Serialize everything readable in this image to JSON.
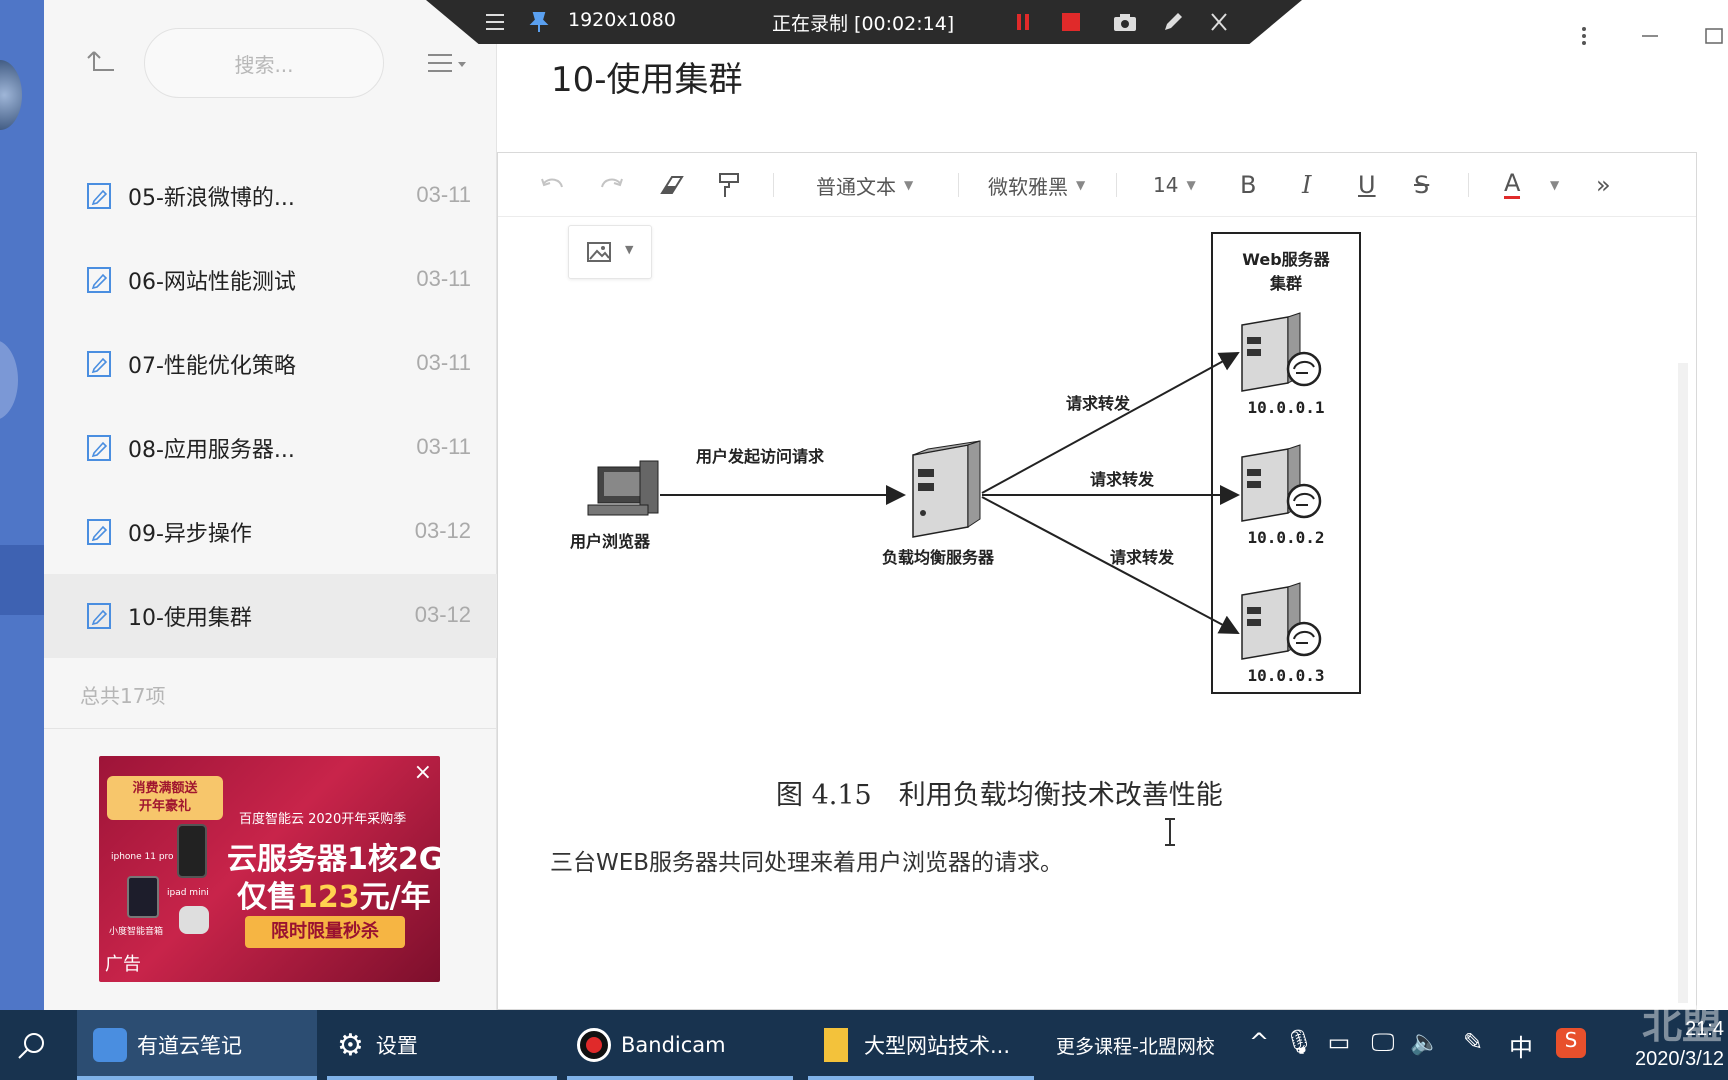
{
  "recording_bar": {
    "resolution": "1920x1080",
    "status": "正在录制 [00:02:14]"
  },
  "search": {
    "placeholder": "搜索..."
  },
  "notes": [
    {
      "title": "05-新浪微博的...",
      "date": "03-11",
      "active": false
    },
    {
      "title": "06-网站性能测试",
      "date": "03-11",
      "active": false
    },
    {
      "title": "07-性能优化策略",
      "date": "03-11",
      "active": false
    },
    {
      "title": "08-应用服务器...",
      "date": "03-11",
      "active": false
    },
    {
      "title": "09-异步操作",
      "date": "03-12",
      "active": false
    },
    {
      "title": "10-使用集群",
      "date": "03-12",
      "active": true
    }
  ],
  "total_label": "总共17项",
  "ad": {
    "ribbon_line1": "消费满额送",
    "ribbon_line2": "开年豪礼",
    "brand": "百度智能云 2020开年采购季",
    "headline1": "云服务器1核2G",
    "headline2_prefix": "仅售",
    "headline2_price": "123",
    "headline2_suffix": "元/年",
    "cta": "限时限量秒杀",
    "product1": "iphone 11 pro",
    "product2": "ipad mini",
    "product3": "小度智能音箱",
    "label": "广告"
  },
  "document": {
    "title": "10-使用集群",
    "caption": "图 4.15　利用负载均衡技术改善性能",
    "body": "三台WEB服务器共同处理来着用户浏览器的请求。"
  },
  "toolbar": {
    "paragraph_style": "普通文本",
    "font_family": "微软雅黑",
    "font_size": "14",
    "bold": "B",
    "italic": "I",
    "underline": "U",
    "strike": "S",
    "font_color": "A",
    "more": "»"
  },
  "diagram": {
    "browser_label": "用户浏览器",
    "request_label": "用户发起访问请求",
    "lb_label": "负载均衡服务器",
    "forward_label": "请求转发",
    "cluster_title_line1": "Web服务器",
    "cluster_title_line2": "集群",
    "servers": [
      "10.0.0.1",
      "10.0.0.2",
      "10.0.0.3"
    ]
  },
  "taskbar": {
    "items": [
      {
        "label": "有道云笔记",
        "active": true
      },
      {
        "label": "设置",
        "active": false
      },
      {
        "label": "Bandicam",
        "active": false
      },
      {
        "label": "大型网站技术...",
        "active": false
      }
    ],
    "more_courses": "更多课程-北盟网校",
    "ime": "中",
    "clock_time": "21:4",
    "clock_date": "2020/3/12",
    "watermark": "北盟"
  },
  "colors": {
    "rail": "#4f76c7",
    "taskbar": "#18334f",
    "accent_icon": "#4a8ee0",
    "rec_red": "#e02a2a"
  }
}
